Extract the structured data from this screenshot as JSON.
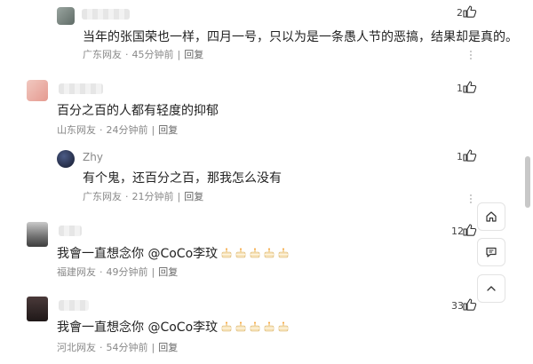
{
  "comments": [
    {
      "text": "当年的张国荣也一样，四月一号，只以为是一条愚人节的恶搞，结果却是真的。",
      "location": "广东网友",
      "time": "45分钟前",
      "reply": "回复",
      "likes": "2"
    },
    {
      "text": "百分之百的人都有轻度的抑郁",
      "location": "山东网友",
      "time": "24分钟前",
      "reply": "回复",
      "likes": "1"
    },
    {
      "name": "Zhy",
      "text": "有个鬼，还百分之百，那我怎么没有",
      "location": "广东网友",
      "time": "21分钟前",
      "reply": "回复",
      "likes": "1"
    },
    {
      "text": "我會一直想念你 @CoCo李玟",
      "location": "福建网友",
      "time": "49分钟前",
      "reply": "回复",
      "likes": "12"
    },
    {
      "text": "我會一直想念你 @CoCo李玟",
      "location": "河北网友",
      "time": "54分钟前",
      "reply": "回复",
      "likes": "33"
    }
  ],
  "side_buttons": [
    "home-icon",
    "comment-icon",
    "chevron-up-icon"
  ],
  "colors": {
    "meta": "#888888",
    "text": "#222222",
    "border": "#e3e3e3"
  }
}
